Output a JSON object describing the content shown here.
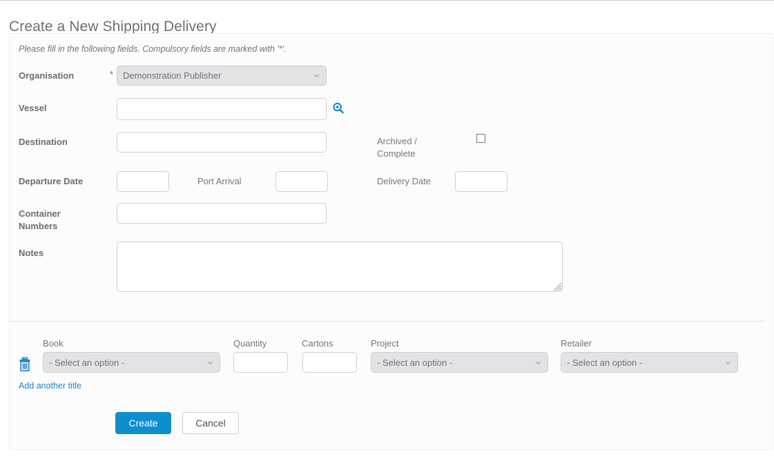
{
  "page": {
    "title": "Create a New Shipping Delivery",
    "hint": "Please fill in the following fields. Compulsory fields are marked with '*'.",
    "required_marker": "*"
  },
  "form": {
    "organisation": {
      "label": "Organisation",
      "value": "Demonstration Publisher",
      "required": true
    },
    "vessel": {
      "label": "Vessel",
      "value": "",
      "placeholder": "",
      "lookup_icon": "magnifier-plus-icon"
    },
    "destination": {
      "label": "Destination",
      "value": "",
      "placeholder": ""
    },
    "archived_complete": {
      "label": "Archived / Complete",
      "label_line1": "Archived /",
      "label_line2": "Complete",
      "checked": false
    },
    "departure_date": {
      "label": "Departure Date",
      "value": "",
      "placeholder": ""
    },
    "port_arrival": {
      "label": "Port Arrival",
      "value": "",
      "placeholder": ""
    },
    "delivery_date": {
      "label": "Delivery Date",
      "value": "",
      "placeholder": ""
    },
    "container_numbers": {
      "label": "Container Numbers",
      "label_line1": "Container",
      "label_line2": "Numbers",
      "value": "",
      "placeholder": ""
    },
    "notes": {
      "label": "Notes",
      "value": "",
      "placeholder": ""
    }
  },
  "titles_section": {
    "columns": {
      "book": "Book",
      "quantity": "Quantity",
      "cartons": "Cartons",
      "project": "Project",
      "retailer": "Retailer"
    },
    "rows": [
      {
        "delete_icon": "trash-icon",
        "book": "- Select an option -",
        "quantity": "",
        "cartons": "",
        "project": "- Select an option -",
        "retailer": "- Select an option -"
      }
    ],
    "add_link": "Add another title",
    "select_placeholder": "- Select an option -"
  },
  "actions": {
    "create": "Create",
    "cancel": "Cancel"
  },
  "colors": {
    "primary": "#0d8ecf",
    "link": "#1b86c8",
    "required": "#e03b3b",
    "label": "#6b6b73",
    "select_bg": "#e3e3e6",
    "card_bg": "#fcfcfd",
    "border": "#cfcfd4"
  }
}
